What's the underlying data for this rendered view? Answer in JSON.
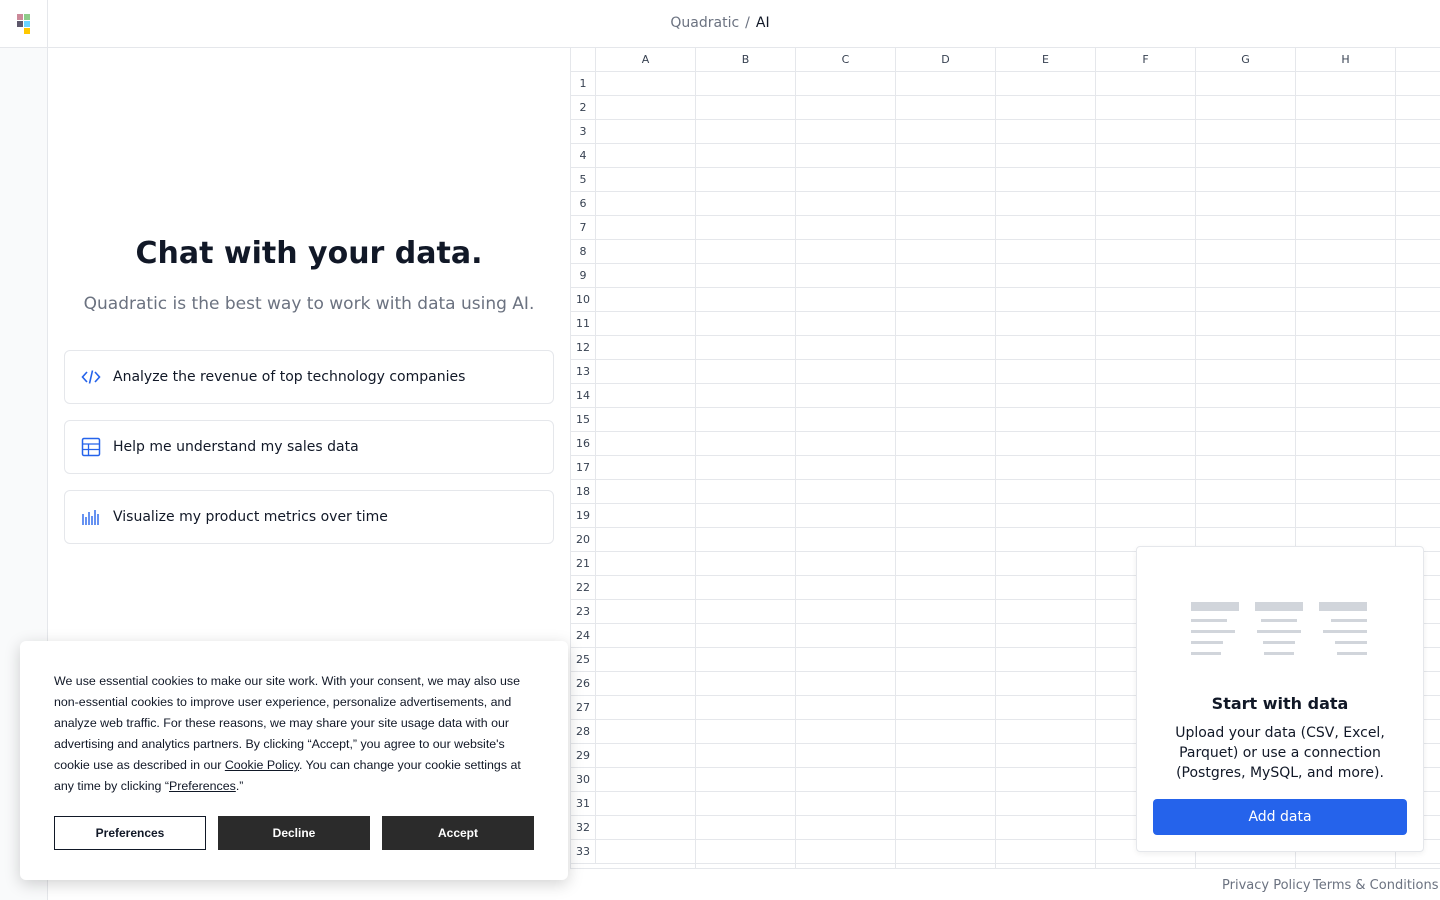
{
  "breadcrumb": {
    "org": "Quadratic",
    "separator": "/",
    "current": "AI"
  },
  "chat": {
    "title": "Chat with your data.",
    "subtitle": "Quadratic is the best way to work with data using AI.",
    "suggestions": [
      {
        "icon": "code-icon",
        "label": "Analyze the revenue of top technology companies"
      },
      {
        "icon": "table-icon",
        "label": "Help me understand my sales data"
      },
      {
        "icon": "chart-bars-icon",
        "label": "Visualize my product metrics over time"
      }
    ]
  },
  "grid": {
    "columns": [
      "A",
      "B",
      "C",
      "D",
      "E",
      "F",
      "G",
      "H"
    ],
    "rows": [
      "1",
      "2",
      "3",
      "4",
      "5",
      "6",
      "7",
      "8",
      "9",
      "10",
      "11",
      "12",
      "13",
      "14",
      "15",
      "16",
      "17",
      "18",
      "19",
      "20",
      "21",
      "22",
      "23",
      "24",
      "25",
      "26",
      "27",
      "28",
      "29",
      "30",
      "31",
      "32",
      "33"
    ]
  },
  "start_card": {
    "title": "Start with data",
    "description": "Upload your data (CSV, Excel, Parquet) or use a connection (Postgres, MySQL, and more).",
    "button": "Add data"
  },
  "cookie": {
    "text_1": "We use essential cookies to make our site work. With your consent, we may also use non-essential cookies to improve user experience, personalize advertisements, and analyze web traffic. For these reasons, we may share your site usage data with our advertising and analytics partners. By clicking “Accept,” you agree to our website's cookie use as described in our ",
    "policy_link": "Cookie Policy",
    "text_2": ". You can change your cookie settings at any time by clicking “",
    "prefs_link": "Preferences",
    "text_3": ".”",
    "preferences": "Preferences",
    "decline": "Decline",
    "accept": "Accept"
  },
  "footer": {
    "privacy": "Privacy Policy",
    "terms": "Terms & Conditions"
  },
  "colors": {
    "accent": "#2563eb",
    "border": "#e5e7eb",
    "cookie_button": "#2b2b2b"
  }
}
